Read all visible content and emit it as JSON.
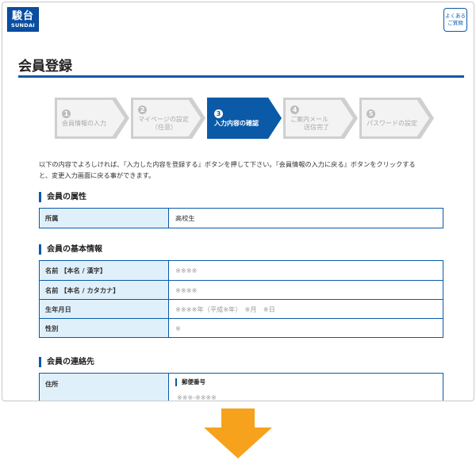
{
  "header": {
    "logo_kanji": "駿台",
    "logo_latin": "SUNDAI",
    "faq_line1": "よくある",
    "faq_line2": "ご質問"
  },
  "page": {
    "title": "会員登録"
  },
  "steps": [
    {
      "number": "1",
      "label": "会員情報の入力",
      "label2": "",
      "active": false
    },
    {
      "number": "2",
      "label": "マイページの設定",
      "label2": "（任意）",
      "active": false
    },
    {
      "number": "3",
      "label": "入力内容の確認",
      "label2": "",
      "active": true
    },
    {
      "number": "4",
      "label": "ご案内メール",
      "label2": "送信完了",
      "active": false
    },
    {
      "number": "5",
      "label": "パスワードの設定",
      "label2": "",
      "active": false
    }
  ],
  "intro": {
    "line1": "以下の内容でよろしければ、『入力した内容を登録する』ボタンを押して下さい。『会員情報の入力に戻る』ボタンをクリックする",
    "line2": "と、変更入力画面に戻る事ができます。"
  },
  "sections": {
    "attribute": {
      "heading": "会員の属性",
      "rows": [
        {
          "label": "所属",
          "value": "高校生"
        }
      ]
    },
    "basic": {
      "heading": "会員の基本情報",
      "rows": [
        {
          "label": "名前 【本名 / 漢字】",
          "value": "※※※※"
        },
        {
          "label": "名前 【本名 / カタカナ】",
          "value": "※※※※"
        },
        {
          "label": "生年月日",
          "value": "※※※※年（平成※年）　※月　※日"
        },
        {
          "label": "性別",
          "value": "※"
        }
      ]
    },
    "contact": {
      "heading": "会員の連絡先",
      "address_label": "住所",
      "postal_heading": "郵便番号",
      "postal_value": "※※※-※※※※"
    }
  },
  "colors": {
    "accent": "#0a5aa8",
    "table_header_bg": "#dff0fb",
    "arrow": "#f6a21c"
  },
  "icons": {
    "next_arrow": "down-arrow-icon"
  }
}
